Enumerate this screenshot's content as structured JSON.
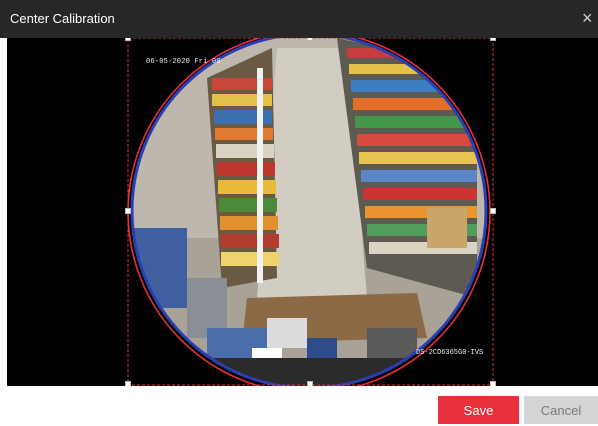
{
  "dialog": {
    "title": "Center Calibration",
    "close_glyph": "×",
    "save_label": "Save",
    "cancel_label": "Cancel"
  },
  "video": {
    "timestamp": "06-05-2020 Fri 00",
    "camera_name": "DS-2CD6365G0-IVS"
  },
  "colors": {
    "accent": "#e8303c",
    "title_bar": "#272727",
    "calibration_circle": "#e8303c",
    "selection_frame": "#e8303c"
  }
}
